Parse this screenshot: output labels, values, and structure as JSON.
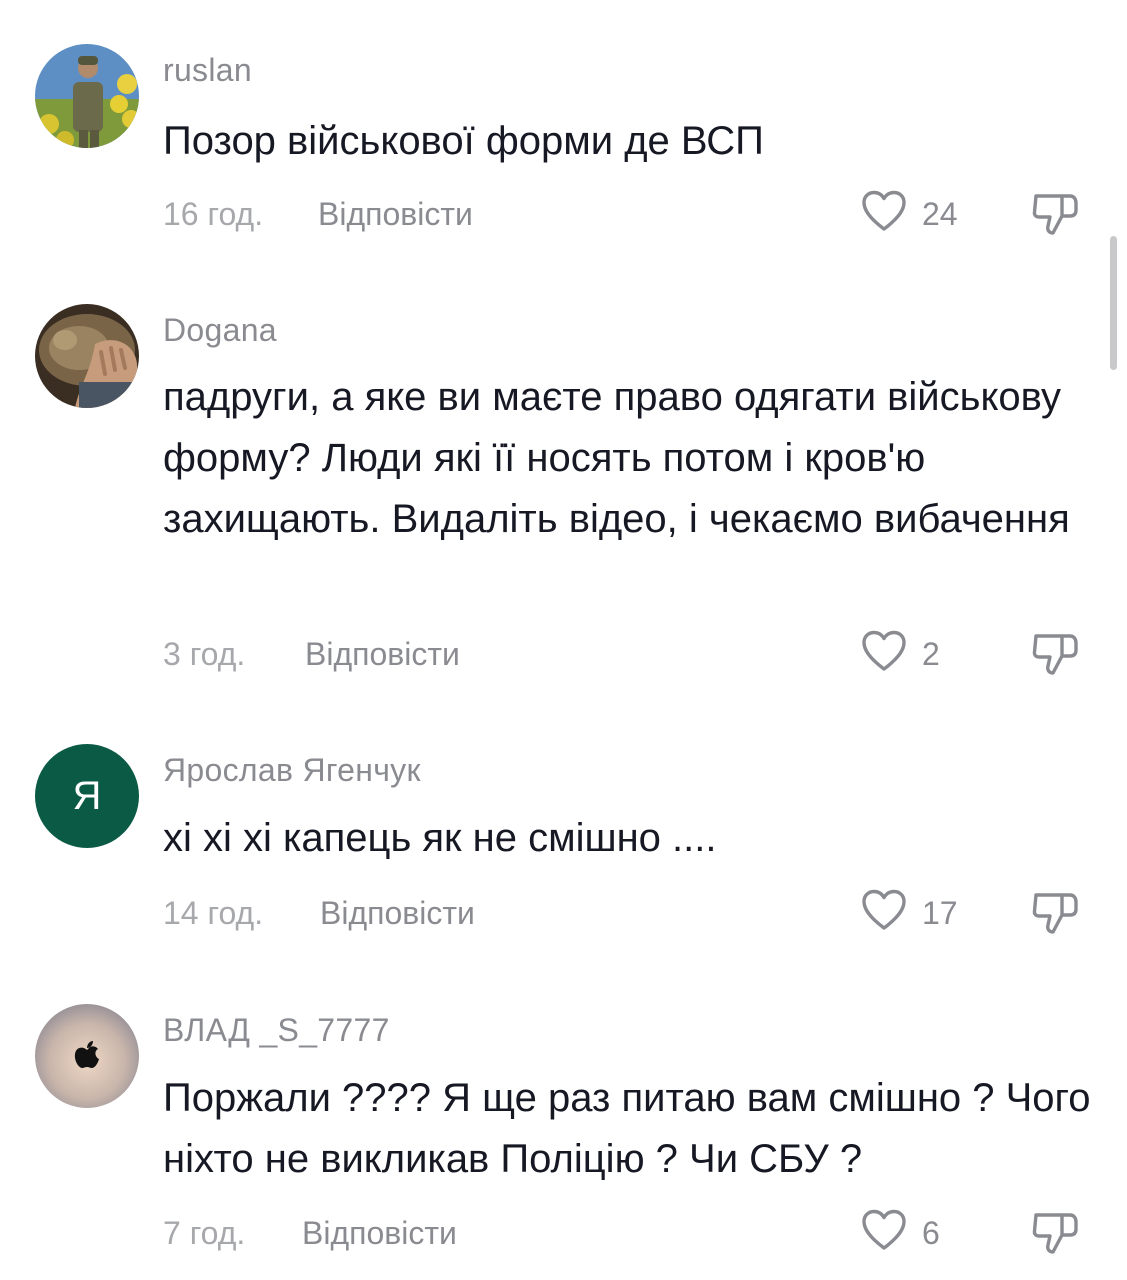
{
  "comments": [
    {
      "username": "ruslan",
      "avatar": "soldier-photo",
      "text": "Позор військової форми де ВСП",
      "time": "16 год.",
      "reply": "Відповісти",
      "likes": "24"
    },
    {
      "username": "Dogana",
      "avatar": "cat-photo",
      "text": "падруги, а яке ви маєте право одягати військову форму? Люди які її носять потом і кров'ю захищають. Видаліть відео, і чекаємо вибачення",
      "time": "3 год.",
      "reply": "Відповісти",
      "likes": "2"
    },
    {
      "username": "Ярослав Ягенчук",
      "avatar": "letter-avatar",
      "avatar_letter": "Я",
      "text": "хі хі хі капець як не смішно ....",
      "time": "14 год.",
      "reply": "Відповісти",
      "likes": "17"
    },
    {
      "username": "ВЛАД _S_7777",
      "avatar": "apple-logo-avatar",
      "text": "Поржали ???? Я ще раз питаю вам смішно ? Чого ніхто не викликав Поліцію ? Чи СБУ ?",
      "time": "7 год.",
      "reply": "Відповісти",
      "likes": "6"
    }
  ],
  "icons": {
    "like": "heart-outline-icon",
    "dislike": "thumbs-down-outline-icon"
  },
  "colors": {
    "text": "#161823",
    "muted": "#8a8b91",
    "time": "#a7a8ac",
    "letter_avatar_bg": "#0b5a45"
  }
}
